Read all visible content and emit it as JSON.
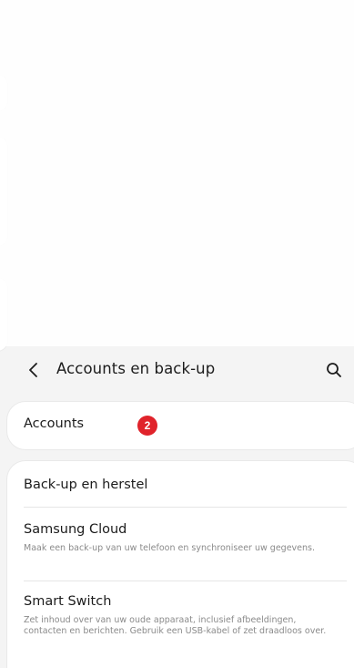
{
  "appbar": {
    "title": "Accounts en back-up",
    "back_icon": "chevron-left-icon",
    "search_icon": "search-icon"
  },
  "accounts": {
    "label": "Accounts",
    "badge": "2",
    "badge_color": "#e0232b"
  },
  "backup_section": {
    "items": [
      {
        "title": "Back-up en herstel",
        "subtitle": ""
      },
      {
        "title": "Samsung Cloud",
        "subtitle": "Maak een back-up van uw telefoon en synchroniseer uw gegevens."
      },
      {
        "title": "Smart Switch",
        "subtitle": "Zet inhoud over van uw oude apparaat, inclusief afbeeldingen, contacten en berichten. Gebruik een USB-kabel of zet draadloos over."
      }
    ]
  }
}
